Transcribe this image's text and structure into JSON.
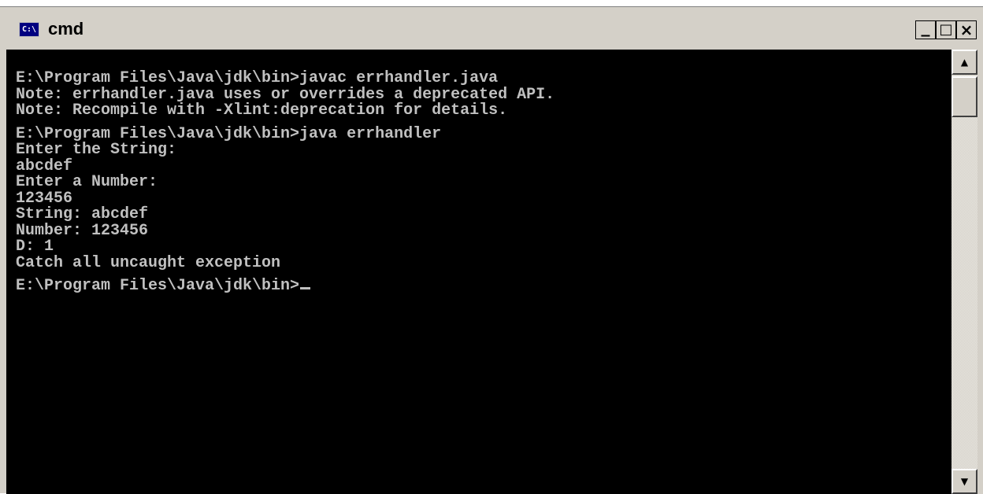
{
  "window": {
    "title": "cmd",
    "icon": "console-icon",
    "icon_text": "C:\\",
    "controls": {
      "minimize": "_",
      "maximize": "□",
      "close": "×"
    }
  },
  "console": {
    "lines": [
      "E:\\Program Files\\Java\\jdk\\bin>javac errhandler.java",
      "Note: errhandler.java uses or overrides a deprecated API.",
      "Note: Recompile with -Xlint:deprecation for details.",
      "",
      "E:\\Program Files\\Java\\jdk\\bin>java errhandler",
      "Enter the String:",
      "abcdef",
      "Enter a Number:",
      "123456",
      "String: abcdef",
      "Number: 123456",
      "D: 1",
      "Catch all uncaught exception",
      "",
      "E:\\Program Files\\Java\\jdk\\bin>"
    ],
    "colors": {
      "background": "#000000",
      "text": "#c0c0c0"
    }
  },
  "scrollbar": {
    "up_arrow": "▲",
    "down_arrow": "▼"
  }
}
